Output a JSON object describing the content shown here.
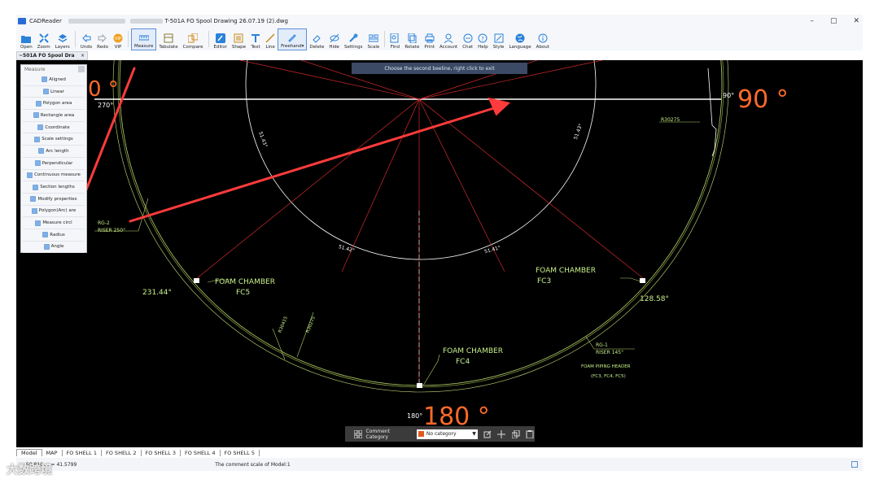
{
  "window": {
    "app_name": "CADReader",
    "file_name": "T-501A FO Spool Drawing 26.07.19 (2).dwg",
    "controls": [
      "–",
      "▢",
      "✕"
    ]
  },
  "toolbar": [
    {
      "id": "open",
      "label": "Open",
      "icon": "folder-icon",
      "color": "#2a82da"
    },
    {
      "id": "zoom",
      "label": "Zoom",
      "icon": "zoom-icon",
      "color": "#2a82da"
    },
    {
      "id": "layers",
      "label": "Layers",
      "icon": "layers-icon",
      "color": "#2a82da"
    },
    {
      "id": "undo",
      "label": "Undo",
      "icon": "undo-icon",
      "color": "#2a82da"
    },
    {
      "id": "redo",
      "label": "Redo",
      "icon": "redo-icon",
      "color": "#9aa4b2"
    },
    {
      "id": "vip",
      "label": "VIP",
      "icon": "vip-icon",
      "color": "#f0a020"
    },
    {
      "id": "measure",
      "label": "Measure",
      "icon": "measure-icon",
      "color": "#2a82da",
      "active": true
    },
    {
      "id": "tabulate",
      "label": "Tabulate",
      "icon": "tabulate-icon",
      "color": "#8a7a3a"
    },
    {
      "id": "compare",
      "label": "Compare",
      "icon": "compare-icon",
      "color": "#d28a1e"
    },
    {
      "id": "editor",
      "label": "Editor",
      "icon": "editor-icon",
      "color": "#2a82da"
    },
    {
      "id": "shape",
      "label": "Shape",
      "icon": "shape-icon",
      "color": "#c68a1a"
    },
    {
      "id": "text",
      "label": "Text",
      "icon": "text-icon",
      "color": "#2a82da"
    },
    {
      "id": "line",
      "label": "Line",
      "icon": "line-icon",
      "color": "#c68a1a"
    },
    {
      "id": "freehand",
      "label": "Freehand▾",
      "icon": "pencil-icon",
      "color": "#2a82da",
      "active": true
    },
    {
      "id": "delete",
      "label": "Delete",
      "icon": "eraser-icon",
      "color": "#2a82da"
    },
    {
      "id": "hide",
      "label": "Hide",
      "icon": "hide-icon",
      "color": "#2a82da"
    },
    {
      "id": "settings",
      "label": "Settings",
      "icon": "settings-icon",
      "color": "#2a82da"
    },
    {
      "id": "scale",
      "label": "Scale",
      "icon": "scale-icon",
      "color": "#2a82da"
    },
    {
      "id": "find",
      "label": "Find",
      "icon": "find-icon",
      "color": "#2a82da"
    },
    {
      "id": "rotate",
      "label": "Rotate",
      "icon": "rotate-icon",
      "color": "#2a82da"
    },
    {
      "id": "print",
      "label": "Print",
      "icon": "print-icon",
      "color": "#2a82da"
    },
    {
      "id": "account",
      "label": "Account",
      "icon": "account-icon",
      "color": "#2a82da"
    },
    {
      "id": "chat",
      "label": "Chat",
      "icon": "chat-icon",
      "color": "#2a82da"
    },
    {
      "id": "help",
      "label": "Help",
      "icon": "help-icon",
      "color": "#2a82da"
    },
    {
      "id": "style",
      "label": "Style",
      "icon": "style-icon",
      "color": "#2a82da"
    },
    {
      "id": "language",
      "label": "Language",
      "icon": "globe-icon",
      "color": "#2a82da"
    },
    {
      "id": "about",
      "label": "About",
      "icon": "info-icon",
      "color": "#2a82da"
    }
  ],
  "doc_tab": {
    "label": "~501A FO Spool Dra",
    "close": "×"
  },
  "hint": "Choose the second beeline, right click to exit",
  "measure_panel": {
    "title": "Measure",
    "items": [
      {
        "label": "Aligned",
        "icon": "aligned-icon"
      },
      {
        "label": "Linear",
        "icon": "linear-icon"
      },
      {
        "label": "Polygon area",
        "icon": "polygon-area-icon"
      },
      {
        "label": "Rectangle area",
        "icon": "rectangle-area-icon"
      },
      {
        "label": "Coordinate",
        "icon": "coordinate-icon"
      },
      {
        "label": "Scale settings",
        "icon": "scale-settings-icon"
      },
      {
        "label": "Arc length",
        "icon": "arc-length-icon"
      },
      {
        "label": "Perpendicular",
        "icon": "perpendicular-icon"
      },
      {
        "label": "Continuous measure",
        "icon": "continuous-measure-icon"
      },
      {
        "label": "Section lengths",
        "icon": "section-lengths-icon"
      },
      {
        "label": "Modify properties",
        "icon": "modify-properties-icon"
      },
      {
        "label": "Polygon(Arc) are",
        "icon": "polygon-arc-icon"
      },
      {
        "label": "Measure circl",
        "icon": "measure-circle-icon"
      },
      {
        "label": "Radius",
        "icon": "radius-icon"
      },
      {
        "label": "Angle",
        "icon": "angle-icon"
      }
    ]
  },
  "drawing": {
    "labels": [
      {
        "text": "270°",
        "color": "#ffffff"
      },
      {
        "text": "90°",
        "color": "#ffffff"
      },
      {
        "text": "90 °",
        "color": "#ff6a2a"
      },
      {
        "text": "180°",
        "color": "#ffffff"
      },
      {
        "text": "180 °",
        "color": "#ff6a2a"
      },
      {
        "text": "231.44°",
        "color": "#c8f08a"
      },
      {
        "text": "128.58°",
        "color": "#c8f08a"
      },
      {
        "text": "FOAM CHAMBER",
        "color": "#c8f08a"
      },
      {
        "text": "FC5",
        "color": "#c8f08a"
      },
      {
        "text": "FC3",
        "color": "#c8f08a"
      },
      {
        "text": "FC4",
        "color": "#c8f08a"
      },
      {
        "text": "R30275",
        "color": "#c8f08a"
      },
      {
        "text": "RG-2",
        "color": "#c8f08a"
      },
      {
        "text": "RISER 250°",
        "color": "#c8f08a"
      },
      {
        "text": "RG-1",
        "color": "#c8f08a"
      },
      {
        "text": "RISER 145°",
        "color": "#c8f08a"
      },
      {
        "text": "FOAM PIPING HEADER",
        "color": "#c8f08a"
      },
      {
        "text": "(FC3, FC4, FC5)",
        "color": "#c8f08a"
      },
      {
        "text": "51.43°",
        "color": "#ffffff"
      },
      {
        "text": "51.41°",
        "color": "#ffffff"
      },
      {
        "text": "51.42°",
        "color": "#ffffff"
      },
      {
        "text": "R30415",
        "color": "#c8f08a"
      },
      {
        "text": "R30275",
        "color": "#c8f08a"
      }
    ],
    "partial_orange": "0 °"
  },
  "comment_bar": {
    "label": "Comment Category",
    "selected": "No category",
    "swatch": "#e05a1c"
  },
  "layout_tabs": [
    "Model",
    "MAP",
    "FO SHELL 1",
    "FO SHELL 2",
    "FO SHELL 3",
    "FO SHELL 4",
    "FO SHELL 5"
  ],
  "status": {
    "coords": "59.810 ... = 41.5799",
    "scale": "The comment scale of Model:1"
  },
  "watermark": "大数跨境"
}
